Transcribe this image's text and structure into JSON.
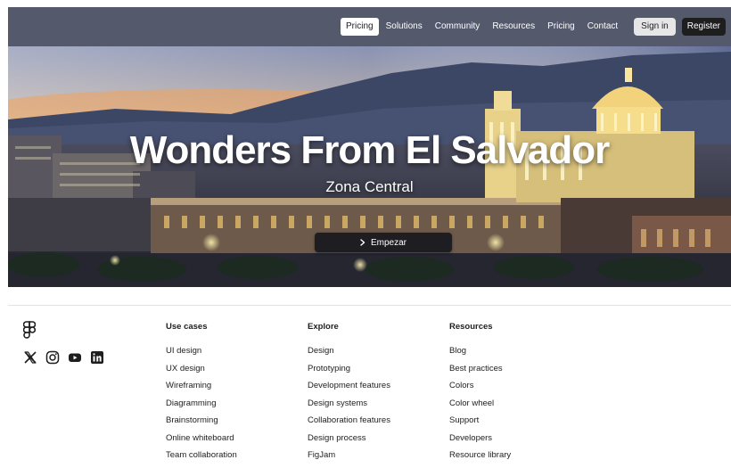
{
  "header": {
    "nav": [
      {
        "label": "Pricing",
        "active": true
      },
      {
        "label": "Solutions",
        "active": false
      },
      {
        "label": "Community",
        "active": false
      },
      {
        "label": "Resources",
        "active": false
      },
      {
        "label": "Pricing",
        "active": false
      },
      {
        "label": "Contact",
        "active": false
      }
    ],
    "sign_in": "Sign in",
    "register": "Register"
  },
  "hero": {
    "title": "Wonders From El Salvador",
    "subtitle": "Zona Central",
    "cta_label": "Empezar",
    "cta_icon": "chevron-right-icon"
  },
  "footer": {
    "brand_icon": "figma-logo-icon",
    "socials": [
      "x-twitter-icon",
      "instagram-icon",
      "youtube-icon",
      "linkedin-icon"
    ],
    "columns": [
      {
        "title": "Use cases",
        "items": [
          "UI design",
          "UX design",
          "Wireframing",
          "Diagramming",
          "Brainstorming",
          "Online whiteboard",
          "Team collaboration"
        ]
      },
      {
        "title": "Explore",
        "items": [
          "Design",
          "Prototyping",
          "Development features",
          "Design systems",
          "Collaboration features",
          "Design process",
          "FigJam"
        ]
      },
      {
        "title": "Resources",
        "items": [
          "Blog",
          "Best practices",
          "Colors",
          "Color wheel",
          "Support",
          "Developers",
          "Resource library"
        ]
      }
    ]
  },
  "colors": {
    "header_bg": "#55596c",
    "button_dark": "#1e1e1e",
    "text": "#1e1e1e"
  }
}
